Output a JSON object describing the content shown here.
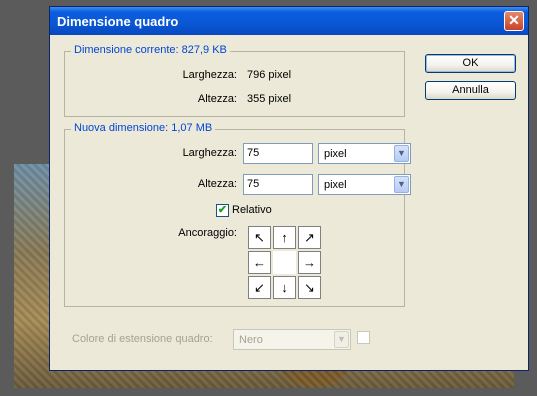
{
  "dialog": {
    "title": "Dimensione quadro",
    "close_symbol": "✕"
  },
  "current_size": {
    "label": "Dimensione corrente: 827,9 KB",
    "width_label": "Larghezza:",
    "width_value": "796 pixel",
    "height_label": "Altezza:",
    "height_value": "355 pixel"
  },
  "new_size": {
    "label": "Nuova dimensione: 1,07 MB",
    "width_label": "Larghezza:",
    "width_value": "75",
    "width_unit": "pixel",
    "height_label": "Altezza:",
    "height_value": "75",
    "height_unit": "pixel",
    "relative_label": "Relativo",
    "relative_checked": true,
    "anchor_label": "Ancoraggio:",
    "anchor_arrows": [
      "↖",
      "↑",
      "↗",
      "←",
      "",
      "→",
      "↙",
      "↓",
      "↘"
    ]
  },
  "extension": {
    "label": "Colore di estensione quadro:",
    "value": "Nero"
  },
  "buttons": {
    "ok": "OK",
    "cancel": "Annulla"
  },
  "icons": {
    "dropdown": "chevron-down-icon",
    "close": "close-icon"
  },
  "colors": {
    "title_bar": "#0a57d4",
    "group_label": "#0046d5",
    "dialog_bg": "#ece9d8"
  }
}
